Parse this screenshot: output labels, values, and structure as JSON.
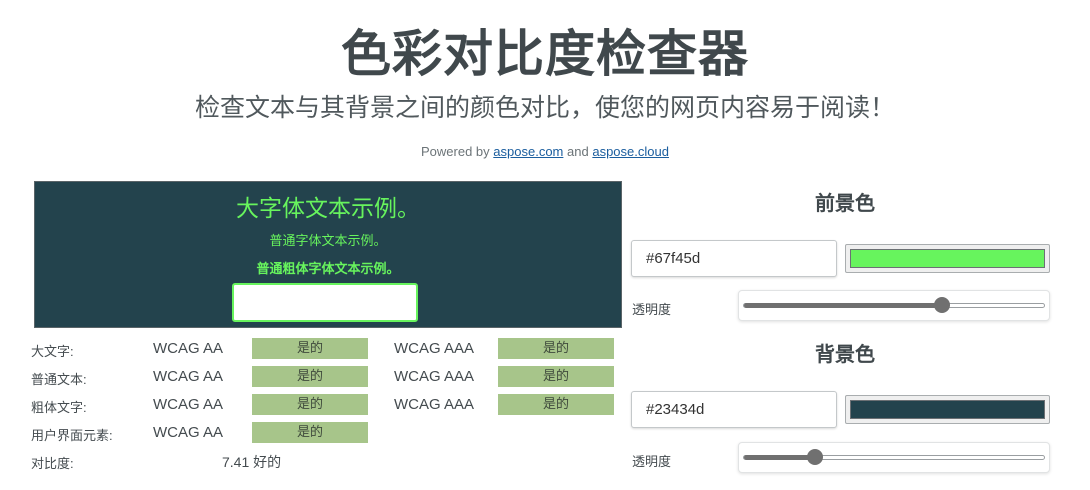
{
  "header": {
    "title": "色彩对比度检查器",
    "subtitle": "检查文本与其背景之间的颜色对比，使您的网页内容易于阅读！",
    "powered_prefix": "Powered by",
    "link1": "aspose.com",
    "and": "and",
    "link2": "aspose.cloud"
  },
  "preview": {
    "large_text": "大字体文本示例。",
    "normal_text": "普通字体文本示例。",
    "bold_text": "普通粗体字体文本示例。",
    "fg_color": "#67f45d",
    "bg_color": "#23434d"
  },
  "results": {
    "rows": [
      {
        "label": "大文字:",
        "aa": "WCAG AA",
        "aa_result": "是的",
        "aaa": "WCAG AAA",
        "aaa_result": "是的"
      },
      {
        "label": "普通文本:",
        "aa": "WCAG AA",
        "aa_result": "是的",
        "aaa": "WCAG AAA",
        "aaa_result": "是的"
      },
      {
        "label": "粗体文字:",
        "aa": "WCAG AA",
        "aa_result": "是的",
        "aaa": "WCAG AAA",
        "aaa_result": "是的"
      },
      {
        "label": "用户界面元素:",
        "aa": "WCAG AA",
        "aa_result": "是的"
      }
    ],
    "ratio_label": "对比度:",
    "ratio_value": "7.41 好的",
    "pass_color": "#a7c58a"
  },
  "foreground": {
    "title": "前景色",
    "hex": "#67f45d",
    "opacity_label": "透明度",
    "opacity": 0.66
  },
  "background": {
    "title": "背景色",
    "hex": "#23434d",
    "opacity_label": "透明度",
    "opacity": 0.24
  }
}
